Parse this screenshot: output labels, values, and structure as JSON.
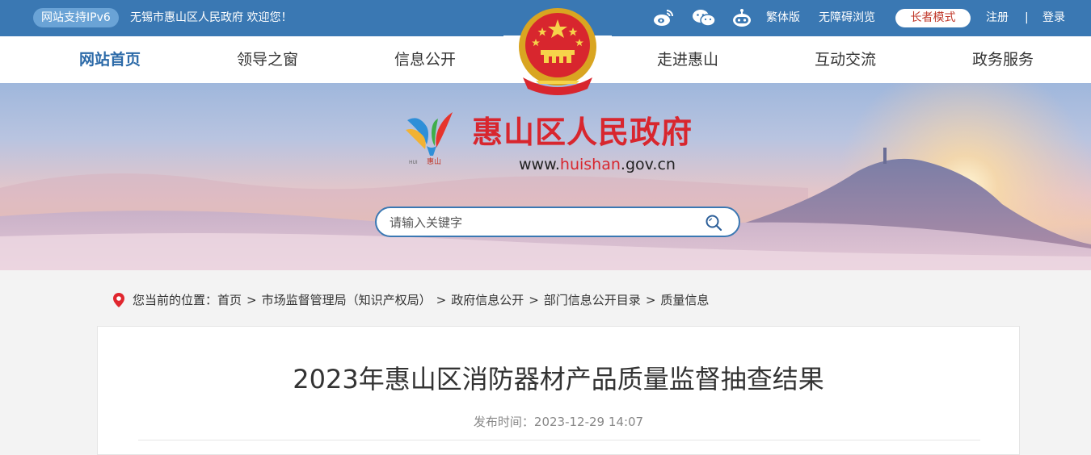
{
  "topbar": {
    "ipv6_badge": "网站支持IPv6",
    "welcome": "无锡市惠山区人民政府 欢迎您！",
    "icons": [
      "weibo-icon",
      "wechat-icon",
      "robot-icon"
    ],
    "traditional": "繁体版",
    "accessible": "无障碍浏览",
    "elder_mode": "长者模式",
    "register": "注册",
    "separator": "|",
    "login": "登录"
  },
  "nav": {
    "items": [
      "网站首页",
      "领导之窗",
      "信息公开",
      "走进惠山",
      "互动交流",
      "政务服务"
    ],
    "active_index": 0
  },
  "banner": {
    "logo_caption": "HUI SHAN 惠山",
    "site_title": "惠山区人民政府",
    "url_prefix": "www.",
    "url_highlight": "huishan",
    "url_suffix": ".gov.cn"
  },
  "search": {
    "placeholder": "请输入关键字",
    "icon": "search-icon"
  },
  "breadcrumb": {
    "label": "您当前的位置：",
    "items": [
      "首页",
      "市场监督管理局（知识产权局）",
      "政府信息公开",
      "部门信息公开目录",
      "质量信息"
    ],
    "separator": ">"
  },
  "article": {
    "title": "2023年惠山区消防器材产品质量监督抽查结果",
    "publish_label": "发布时间：",
    "publish_time": "2023-12-29 14:07"
  },
  "colors": {
    "topbar": "#3a78b3",
    "accent_red": "#d8262e",
    "nav_active": "#2c6aa8"
  }
}
